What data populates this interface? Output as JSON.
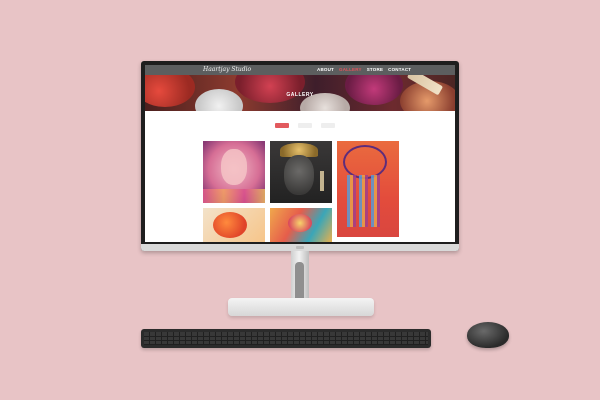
{
  "site": {
    "logo": "Haartjay Studio",
    "nav": [
      {
        "label": "ABOUT",
        "active": false
      },
      {
        "label": "GALLERY",
        "active": true
      },
      {
        "label": "STORE",
        "active": false
      },
      {
        "label": "CONTACT",
        "active": false
      }
    ],
    "hero_title": "GALLERY",
    "filters": [
      {
        "label": "",
        "active": true
      },
      {
        "label": "",
        "active": false
      },
      {
        "label": "",
        "active": false
      }
    ],
    "gallery": [
      {
        "name": "pink-face-painting"
      },
      {
        "name": "buddha-painting"
      },
      {
        "name": "dreamcatcher-painting"
      },
      {
        "name": "koi-fish-painting"
      },
      {
        "name": "abstract-flower-painting"
      }
    ]
  },
  "colors": {
    "background": "#e8c4c6",
    "nav_bg": "#5c5e5f",
    "accent": "#e0535b"
  }
}
